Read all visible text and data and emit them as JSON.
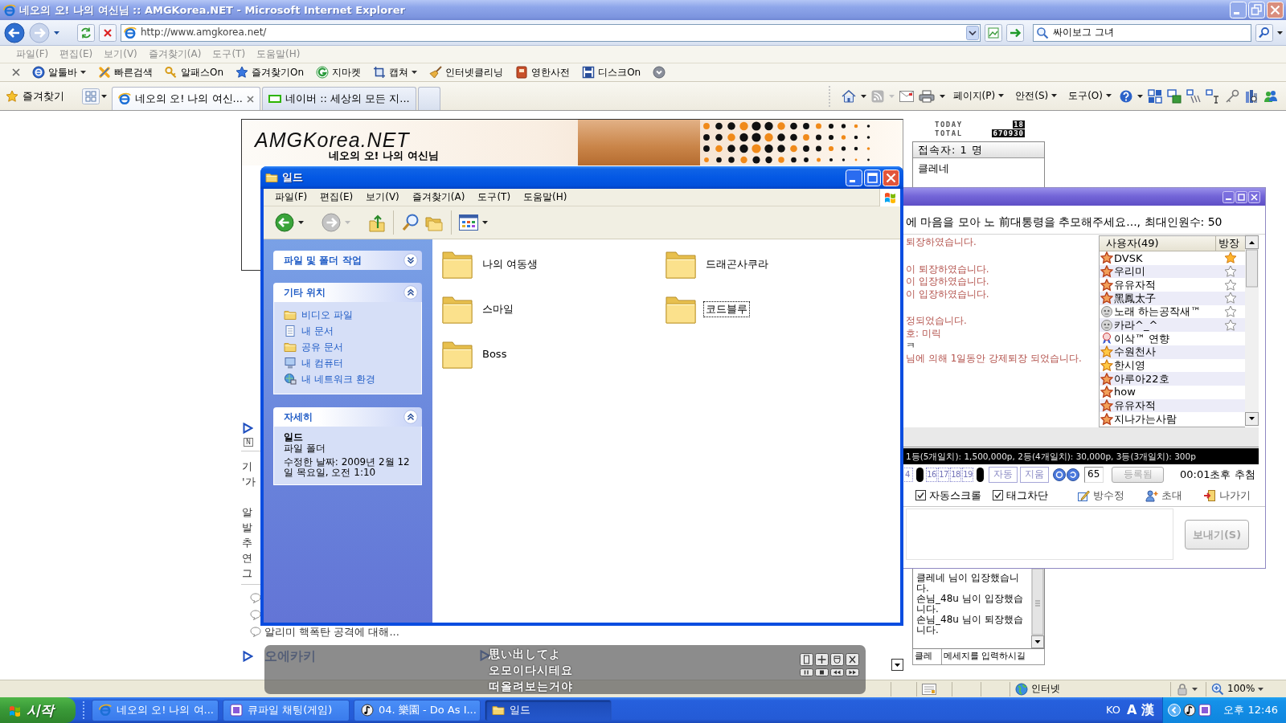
{
  "ie_window": {
    "title": "네오의 오! 나의 여신님 :: AMGKorea.NET - Microsoft Internet Explorer"
  },
  "address_bar": {
    "url": "http://www.amgkorea.net/",
    "search_value": "싸이보그 그녀"
  },
  "menu_bar": [
    "파일(F)",
    "편집(E)",
    "보기(V)",
    "즐겨찾기(A)",
    "도구(T)",
    "도움말(H)"
  ],
  "links_toolbar": [
    {
      "label": "알툴바",
      "dropdown": true
    },
    {
      "label": "빠른검색",
      "dropdown": false
    },
    {
      "label": "알패스On",
      "dropdown": false
    },
    {
      "label": "즐겨찾기On",
      "dropdown": false
    },
    {
      "label": "지마켓",
      "dropdown": false
    },
    {
      "label": "캡쳐",
      "dropdown": true
    },
    {
      "label": "인터넷클리닝",
      "dropdown": false
    },
    {
      "label": "영한사전",
      "dropdown": false
    },
    {
      "label": "디스크On",
      "dropdown": false
    }
  ],
  "tab_bar": {
    "favorites": "즐겨찾기",
    "tabs": [
      {
        "label": "네오의 오! 나의 여신...",
        "selected": true
      },
      {
        "label": "네이버 :: 세상의 모든 지...",
        "selected": false
      }
    ],
    "commands": [
      "페이지(P)",
      "안전(S)",
      "도구(O)"
    ]
  },
  "page": {
    "banner": {
      "logo": "AMGKorea.NET",
      "subtitle": "네오의 오! 나의 여신님"
    },
    "new_badge": "N",
    "article_paragraphs": [
      [
        "기",
        "'가"
      ],
      [
        "알",
        "발",
        "추",
        "연",
        "그"
      ]
    ],
    "comments": [
      {
        "kind": "covered"
      },
      {
        "kind": "covered"
      },
      {
        "kind": "visible",
        "text": "알리미 핵폭탄 공격에 대해..."
      }
    ],
    "section_heading": "오에카키"
  },
  "sidebar": {
    "counter": {
      "today_label": "TODAY",
      "today": "18",
      "total_label": "TOTAL",
      "total": "670930"
    },
    "online_header": "접속자: 1 명",
    "online_users": [
      "클레네"
    ],
    "mini_chat": {
      "messages": [
        "클레네 님이 입장했습니다.",
        "손님_48u 님이 입장했습니다.",
        "손님_48u 님이 퇴장했습니다."
      ],
      "nick_value": "클레",
      "message_value": "메세지를 입력하시길"
    }
  },
  "status_bar": {
    "zone": "인터넷",
    "zoom": "100%"
  },
  "chat": {
    "topic": "에 마음을 모아 노 前대통령을 추모해주세요..., 최대인원수: 50",
    "message_groups": [
      [
        {
          "kind": "notice",
          "text": "퇴장하였습니다."
        }
      ],
      [
        {
          "kind": "notice",
          "text": "이 퇴장하였습니다."
        },
        {
          "kind": "notice",
          "text": "이 입장하였습니다."
        },
        {
          "kind": "notice",
          "text": "이 입장하였습니다."
        }
      ],
      [
        {
          "kind": "notice",
          "text": "정되었습니다."
        },
        {
          "kind": "notice",
          "text": "호: 미릭"
        },
        {
          "kind": "chat",
          "text": "ㅋ"
        },
        {
          "kind": "notice",
          "text": "님에 의해 1일동안 강제퇴장 되었습니다."
        }
      ]
    ],
    "user_columns": [
      "사용자(49)",
      "방장"
    ],
    "users": [
      {
        "name": "DVSK",
        "kind": "member",
        "host": true,
        "op": false
      },
      {
        "name": "우리미",
        "kind": "member",
        "host": false,
        "op": true
      },
      {
        "name": "유유자적",
        "kind": "member",
        "host": false,
        "op": true
      },
      {
        "name": "黑鳳太子",
        "kind": "member",
        "host": false,
        "op": true
      },
      {
        "name": "노래 하는공작새™",
        "kind": "guest",
        "host": false,
        "op": true
      },
      {
        "name": "카라^_^",
        "kind": "guest",
        "host": false,
        "op": true
      },
      {
        "name": "이삭™ 연향",
        "kind": "award",
        "host": false,
        "op": false
      },
      {
        "name": "수원천사",
        "kind": "vip",
        "host": false,
        "op": false
      },
      {
        "name": "한시영",
        "kind": "vip",
        "host": false,
        "op": false
      },
      {
        "name": "아루아22호",
        "kind": "member",
        "host": false,
        "op": false
      },
      {
        "name": "how",
        "kind": "member",
        "host": false,
        "op": false
      },
      {
        "name": "유유자적",
        "kind": "member",
        "host": false,
        "op": false
      },
      {
        "name": "지나가는사람",
        "kind": "member",
        "host": false,
        "op": false
      }
    ],
    "prize_banner": "1등(5개일치): 1,500,000p, 2등(4개일치): 30,000p, 3등(3개일치): 300p",
    "lottery": {
      "numbers": [
        {
          "label": "4",
          "selected": false
        },
        {
          "selected": true
        },
        {
          "label": "16",
          "selected": false
        },
        {
          "label": "17",
          "selected": false
        },
        {
          "label": "18",
          "selected": false
        },
        {
          "label": "19",
          "selected": false
        },
        {
          "selected": true
        }
      ],
      "buttons": [
        "자동",
        "지움"
      ],
      "count": "65",
      "register": {
        "label": "등록됨",
        "disabled": true
      },
      "timer": "00:01초후 추첨"
    },
    "options": [
      {
        "kind": "checkbox",
        "label": "자동스크롤",
        "checked": true
      },
      {
        "kind": "checkbox",
        "label": "태그차단",
        "checked": true
      },
      {
        "kind": "action",
        "label": "방수정"
      },
      {
        "kind": "action",
        "label": "초대"
      },
      {
        "kind": "action",
        "label": "나가기"
      }
    ],
    "send_button": {
      "label": "보내기(S)",
      "disabled": true
    }
  },
  "explorer": {
    "title": "일드",
    "menu": [
      "파일(F)",
      "편집(E)",
      "보기(V)",
      "즐겨찾기(A)",
      "도구(T)",
      "도움말(H)"
    ],
    "task_panels": [
      {
        "title": "파일 및 폴더 작업",
        "expanded": false
      },
      {
        "title": "기타 위치",
        "kind": "links",
        "expanded": true,
        "items": [
          "비디오 파일",
          "내 문서",
          "공유 문서",
          "내 컴퓨터",
          "내 네트워크 환경"
        ]
      },
      {
        "title": "자세히",
        "kind": "details",
        "expanded": true,
        "name": "일드",
        "type": "파일 폴더",
        "modified": "수정한 날짜: 2009년 2월 12일 목요일, 오전 1:10"
      }
    ],
    "folders": [
      {
        "name": "나의 여동생",
        "selected": false
      },
      {
        "name": "드래곤사쿠라",
        "selected": false
      },
      {
        "name": "스마일",
        "selected": false
      },
      {
        "name": "코드블루",
        "selected": true
      },
      {
        "name": "Boss",
        "selected": false
      }
    ]
  },
  "lyrics": {
    "lines": [
      "思い出してよ",
      "오모이다시테요",
      "떠올려보는거야"
    ]
  },
  "taskbar": {
    "start": "시작",
    "tasks": [
      {
        "label": "네오의 오! 나의 여...",
        "selected": false
      },
      {
        "label": "큐파일 채팅(게임)",
        "selected": false
      },
      {
        "label": "04. 樂園 - Do As I...",
        "selected": false
      },
      {
        "label": "일드",
        "selected": true
      }
    ],
    "tray": {
      "language": "KO",
      "input_mode": "A",
      "hanja": "漢",
      "clock": "오후 12:46"
    }
  }
}
